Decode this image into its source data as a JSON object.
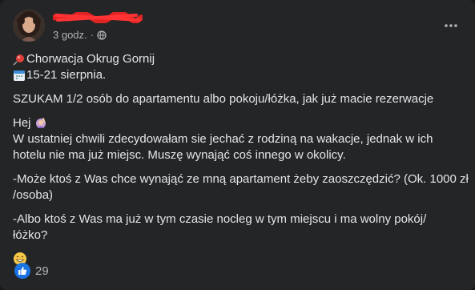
{
  "colors": {
    "card_bg": "#242526",
    "text_primary": "#e4e6eb",
    "text_secondary": "#b0b3b8",
    "like_blue": "#1b74e4",
    "redaction_red": "#e02424"
  },
  "post": {
    "author_name": "",
    "time": "3 godz.",
    "meta_separator": "·",
    "privacy_icon": "globe-icon",
    "more_icon": "more-options-icon",
    "lines": {
      "location": "Chorwacja Okrug Gornij",
      "dates": "15-21 sierpnia.",
      "seeking": "SZUKAM 1/2 osób do apartamentu albo pokoju/łóżka, jak już macie rezerwacje",
      "greeting": "Hej",
      "story_1": "W ustatniej chwili zdecydowałam sie jechać z rodziną na wakacje, jednak w ich",
      "story_2": "hotelu nie ma już miejsc. Muszę wynająć coś innego w okolicy.",
      "q1_1": "-Może ktoś z Was chce wynająć ze mną apartament żeby zaoszczędzić? (Ok. 1000 zł",
      "q1_2": "/osoba)",
      "q2_1": "-Albo ktoś z Was ma już w tym czasie nocleg w tym miejscu i ma wolny pokój/",
      "q2_2": "łóżko?"
    },
    "icons": {
      "location": "round-pushpin-icon",
      "dates": "calendar-icon",
      "greeting": "person-raising-hand-icon",
      "closing": "grinning-face-icon"
    }
  },
  "reactions": {
    "icon": "like-icon",
    "count": "29"
  }
}
